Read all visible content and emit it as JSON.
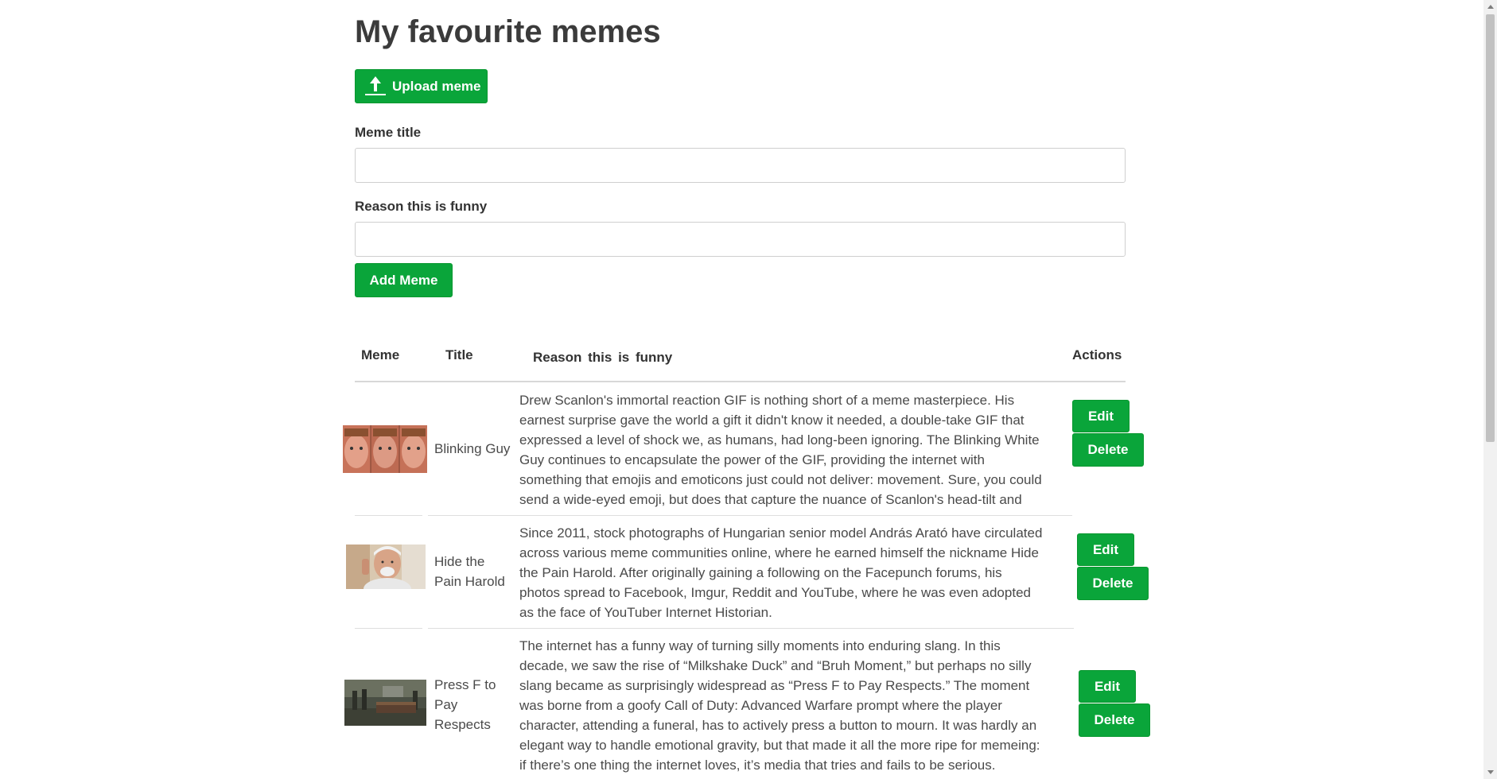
{
  "page": {
    "title": "My favourite memes"
  },
  "upload": {
    "label": "Upload meme",
    "icon": "upload-icon"
  },
  "form": {
    "title_label": "Meme title",
    "title_value": "",
    "title_placeholder": "",
    "reason_label": "Reason this is funny",
    "reason_value": "",
    "reason_placeholder": "",
    "submit_label": "Add Meme"
  },
  "table": {
    "headers": {
      "meme": "Meme",
      "title": "Title",
      "reason": "Reason this is funny",
      "actions": "Actions"
    },
    "rows": [
      {
        "title": "Blinking Guy",
        "reason": "Drew Scanlon's immortal reaction GIF is nothing short of a meme masterpiece. His earnest surprise gave the world a gift it didn't know it needed, a double-take GIF that expressed a level of shock we, as humans, had long-been ignoring. The Blinking White Guy continues to encapsulate the power of the GIF, providing the internet with something that emojis and emoticons just could not deliver: movement. Sure, you could send a wide-eyed emoji, but does that capture the nuance of Scanlon's head-tilt and knee-jerking blinking? No",
        "edit_label": "Edit",
        "delete_label": "Delete"
      },
      {
        "title": "Hide the Pain Harold",
        "reason": "Since 2011, stock photographs of Hungarian senior model András Arató have circulated across various meme communities online, where he earned himself the nickname Hide the Pain Harold. After originally gaining a following on the Facepunch forums, his photos spread to Facebook, Imgur, Reddit and YouTube, where he was even adopted as the face of YouTuber Internet Historian.",
        "edit_label": "Edit",
        "delete_label": "Delete"
      },
      {
        "title": "Press F to Pay Respects",
        "reason": "The internet has a funny way of turning silly moments into enduring slang. In this decade, we saw the rise of “Milkshake Duck” and “Bruh Moment,” but perhaps no silly slang became as surprisingly widespread as “Press F to Pay Respects.” The moment was borne from a goofy Call of Duty: Advanced Warfare prompt where the player character, attending a funeral, has to actively press a button to mourn. It was hardly an elegant way to handle emotional gravity, but that made it all the more ripe for memeing: if there’s one thing the internet loves, it’s media that tries and fails to be serious.",
        "edit_label": "Edit",
        "delete_label": "Delete"
      }
    ]
  },
  "colors": {
    "accent": "#0aa53a",
    "text": "#333333"
  }
}
